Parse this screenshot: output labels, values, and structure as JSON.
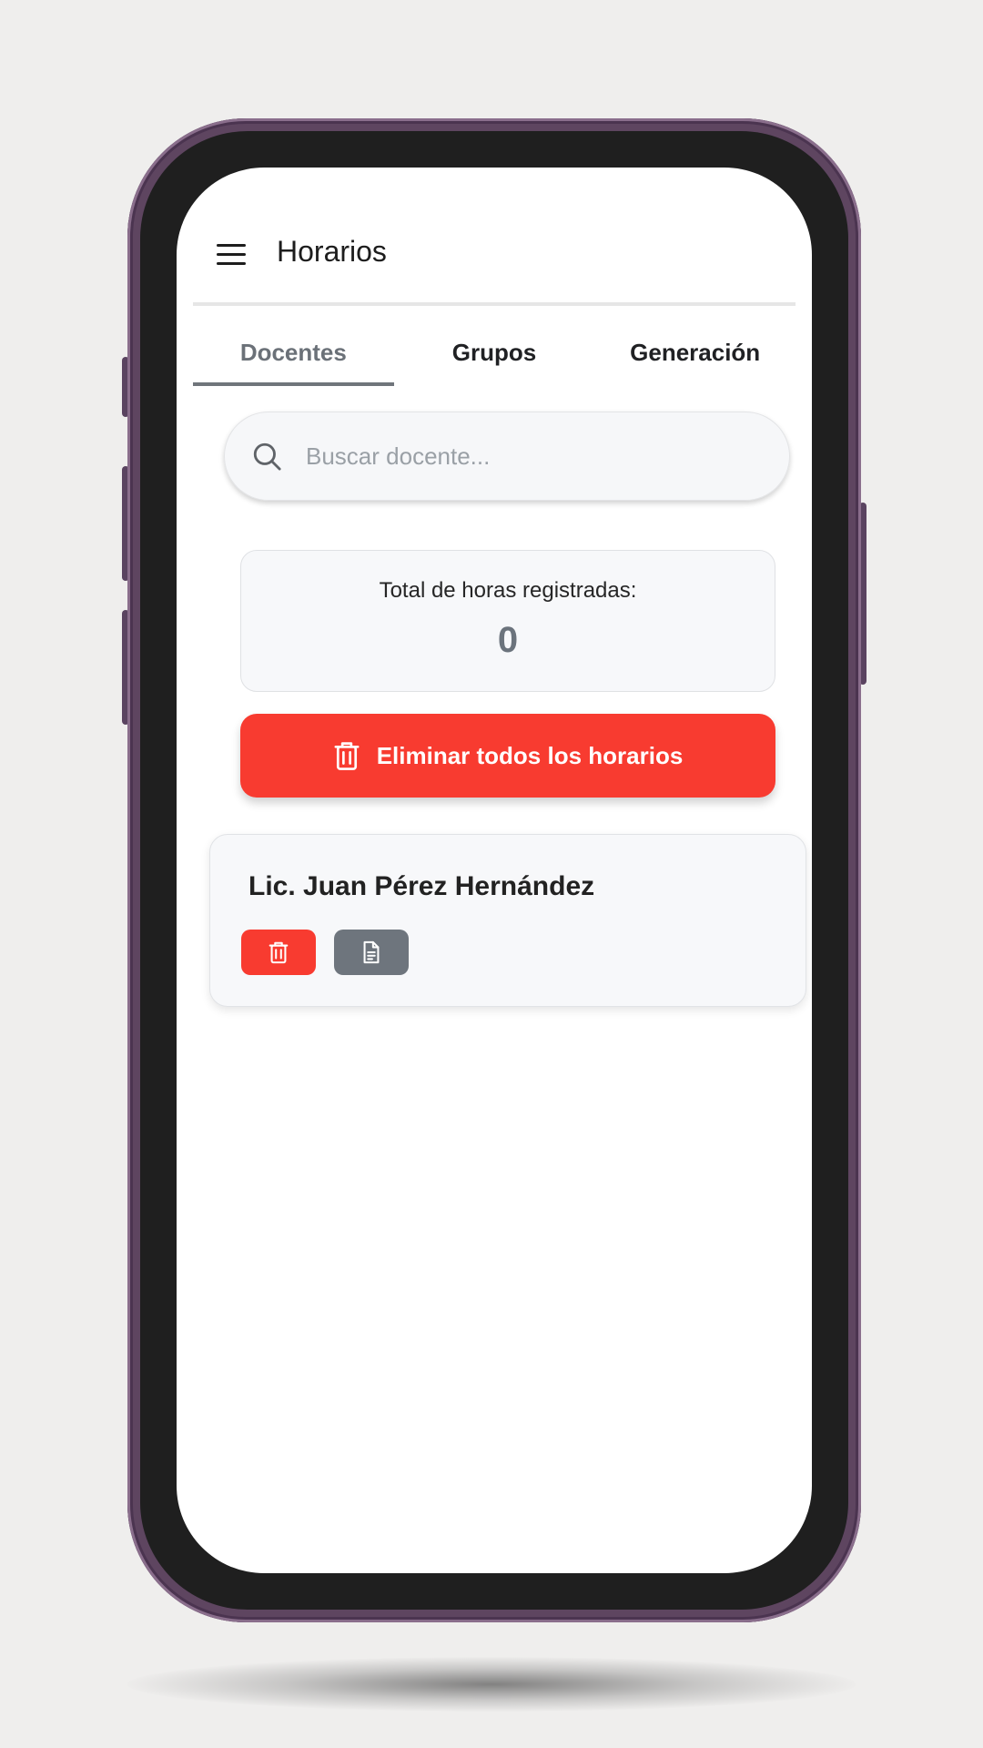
{
  "appbar": {
    "title": "Horarios",
    "menu_icon": "hamburger-menu-icon"
  },
  "tabs": [
    {
      "label": "Docentes",
      "active": true
    },
    {
      "label": "Grupos",
      "active": false
    },
    {
      "label": "Generación",
      "active": false
    }
  ],
  "search": {
    "placeholder": "Buscar docente...",
    "value": "",
    "icon": "search-icon"
  },
  "summary": {
    "label": "Total de horas registradas:",
    "value": "0"
  },
  "delete_all": {
    "label": "Eliminar todos los horarios",
    "icon": "trash-icon",
    "color": "#f83b30"
  },
  "teachers": [
    {
      "name": "Lic. Juan Pérez Hernández",
      "actions": [
        {
          "icon": "trash-icon",
          "color": "#f83b30"
        },
        {
          "icon": "document-icon",
          "color": "#6e757d"
        }
      ]
    }
  ],
  "colors": {
    "accent_red": "#f83b30",
    "tab_indicator": "#70757b",
    "phone_frame": "#5e4560"
  }
}
